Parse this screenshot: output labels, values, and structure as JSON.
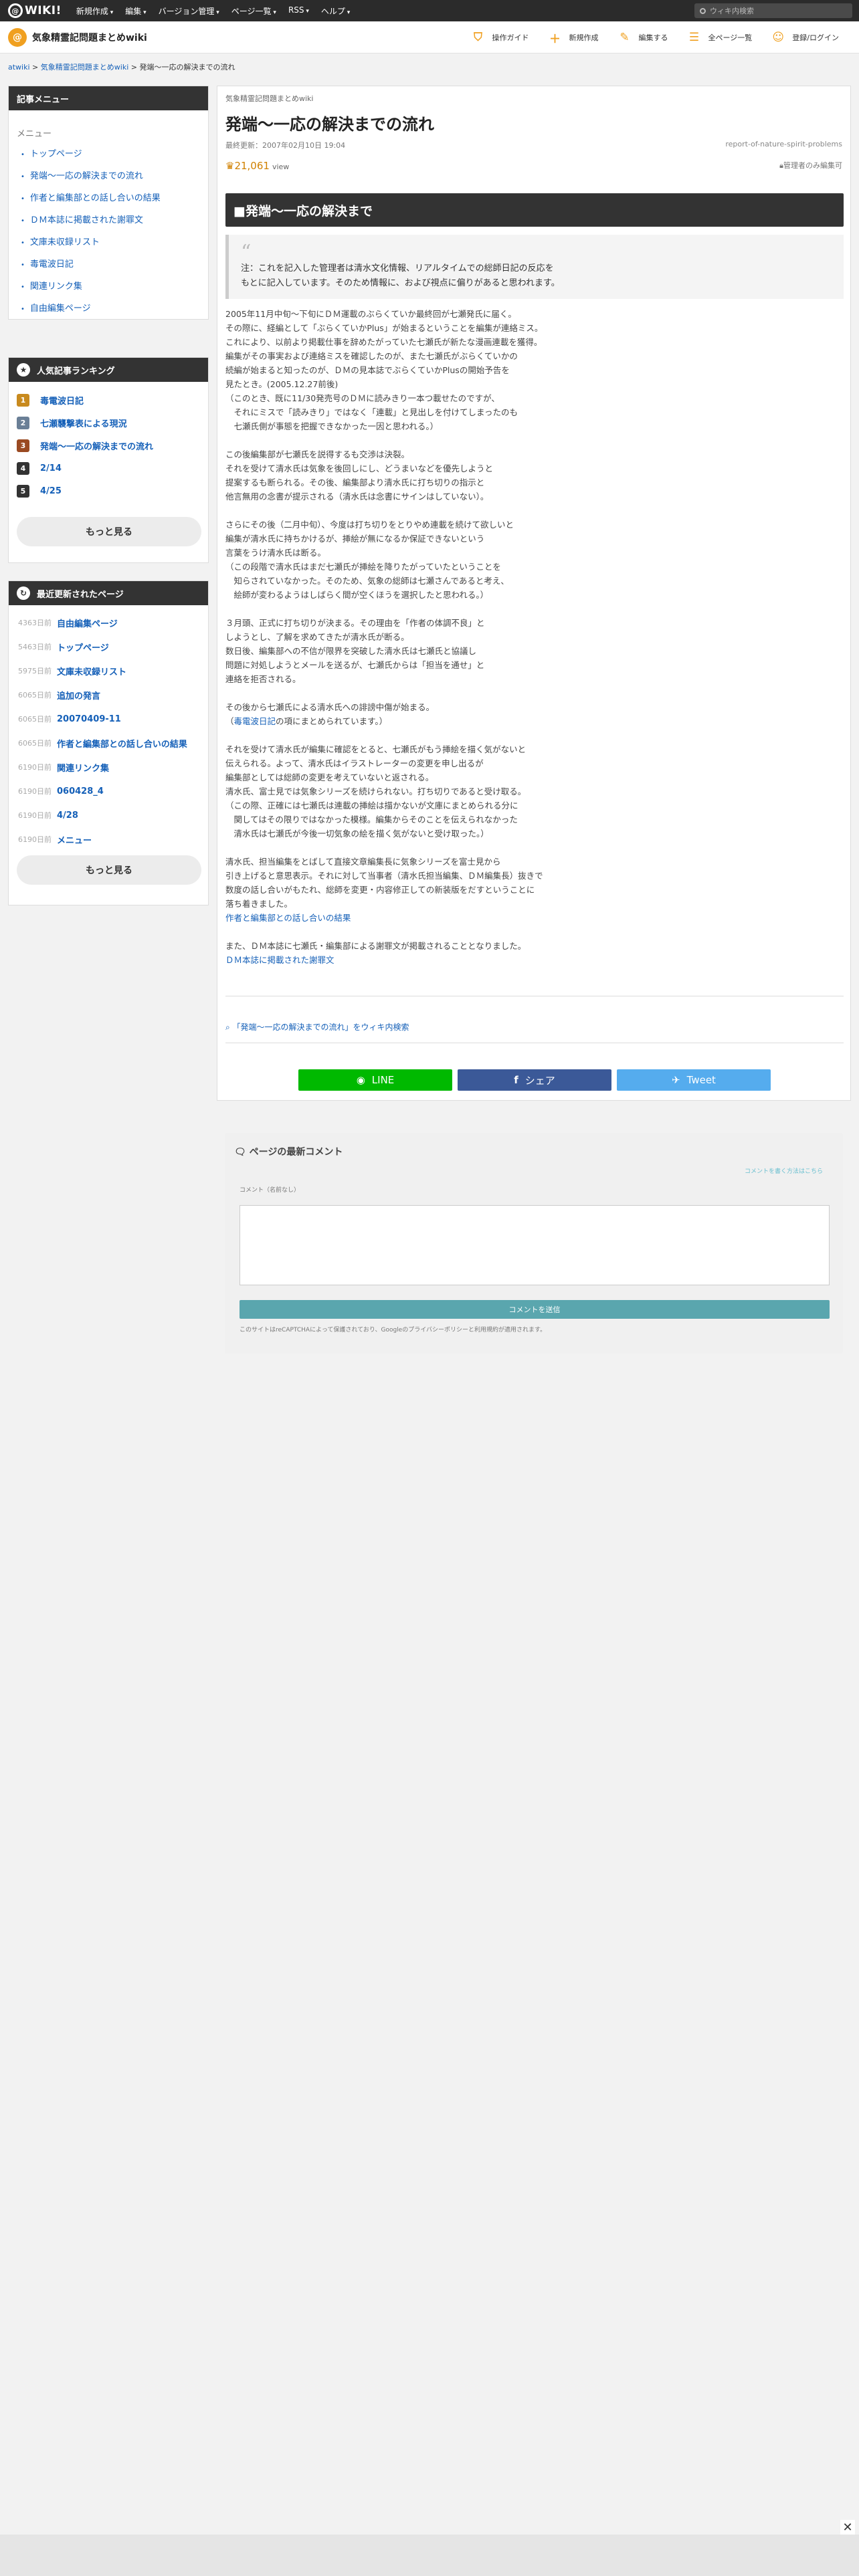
{
  "topbar": {
    "logo_text": "WIKI!",
    "menu": [
      "新規作成",
      "編集",
      "バージョン管理",
      "ページ一覧",
      "RSS",
      "ヘルプ"
    ],
    "search_placeholder": "ウィキ内検索"
  },
  "site": {
    "title": "気象精霊記問題まとめwiki",
    "nav": [
      "操作ガイド",
      "新規作成",
      "編集する",
      "全ページ一覧",
      "登録/ログイン"
    ]
  },
  "breadcrumb": {
    "root": "atwiki",
    "site": "気象精霊記問題まとめwiki",
    "current": "発端〜一応の解決までの流れ"
  },
  "sidebar": {
    "menu_title": "記事メニュー",
    "menu_caption": "メニュー",
    "menu_items": [
      "トップページ",
      "発端〜一応の解決までの流れ",
      "作者と編集部との話し合いの結果",
      "ＤＭ本誌に掲載された謝罪文",
      "文庫未収録リスト",
      "毒電波日記",
      "関連リンク集",
      "自由編集ページ"
    ],
    "ranking_title": "人気記事ランキング",
    "ranking": [
      {
        "rank": "1",
        "label": "毒電波日記",
        "color": "#c88a1e"
      },
      {
        "rank": "2",
        "label": "七瀬襲撃表による現況",
        "color": "#6a7f96"
      },
      {
        "rank": "3",
        "label": "発端〜一応の解決までの流れ",
        "color": "#9a4a22"
      },
      {
        "rank": "4",
        "label": "2/14",
        "color": "#333333"
      },
      {
        "rank": "5",
        "label": "4/25",
        "color": "#333333"
      }
    ],
    "more_label": "もっと見る",
    "recent_title": "最近更新されたページ",
    "recent": [
      {
        "ago": "4363日前",
        "label": "自由編集ページ"
      },
      {
        "ago": "5463日前",
        "label": "トップページ"
      },
      {
        "ago": "5975日前",
        "label": "文庫未収録リスト"
      },
      {
        "ago": "6065日前",
        "label": "追加の発言"
      },
      {
        "ago": "6065日前",
        "label": "20070409-11"
      },
      {
        "ago": "6065日前",
        "label": "作者と編集部との話し合いの結果"
      },
      {
        "ago": "6190日前",
        "label": "関連リンク集"
      },
      {
        "ago": "6190日前",
        "label": "060428_4"
      },
      {
        "ago": "6190日前",
        "label": "4/28"
      },
      {
        "ago": "6190日前",
        "label": "メニュー"
      }
    ]
  },
  "article": {
    "site_name": "気象精霊記問題まとめwiki",
    "title": "発端〜一応の解決までの流れ",
    "last_modified": "最終更新：2007年02月10日 19:04",
    "slug": "report-of-nature-spirit-problems",
    "views": "21,061",
    "views_unit": "view",
    "admin_only": "管理者のみ編集可",
    "heading": "■発端〜一応の解決まで",
    "quote": "注：これを記入した管理者は清水文化情報、リアルタイムでの総師日記の反応を\nもとに記入しています。そのため情報に、および視点に偏りがあると思われます。",
    "paragraphs": [
      "2005年11月中旬〜下旬にＤＭ運載のぶらくていか最終回が七瀬発氏に届く。\nその際に、経編として「ぶらくていかPlus」が始まるということを編集が連絡ミス。\nこれにより、以前より掲載仕事を辞めたがっていた七瀬氏が新たな漫画連載を獲得。\n編集がその事実および連絡ミスを確認したのが、また七瀬氏がぶらくていかの\n続編が始まると知ったのが、ＤＭの見本誌でぶらくていかPlusの開始予告を\n見たとき。(2005.12.27前後)\n（このとき、既に11/30発売号のＤＭに読みきり一本つ載せたのですが、\n　それにミスで「読みきり」ではなく「連載」と見出しを付けてしまったのも\n　七瀬氏側が事態を把握できなかった一因と思われる。）",
      "この後編集部が七瀬氏を説得するも交渉は決裂。\nそれを受けて清水氏は気象を後回しにし、どうまいなどを優先しようと\n提案するも断られる。その後、編集部より清水氏に打ち切りの指示と\n他言無用の念書が提示される（清水氏は念書にサインはしていない）。",
      "さらにその後（二月中旬）、今度は打ち切りをとりやめ連載を続けて欲しいと\n編集が清水氏に持ちかけるが、挿絵が無になるか保証できないという\n言葉をうけ清水氏は断る。\n（この段階で清水氏はまだ七瀬氏が挿絵を降りたがっていたということを\n　知らされていなかった。そのため、気象の総師は七瀬さんであると考え、\n　絵師が変わるようはしばらく間が空くほうを選択したと思われる。）",
      "３月頭、正式に打ち切りが決まる。その理由を「作者の体調不良」と\nしようとし、了解を求めてきたが清水氏が断る。\n数日後、編集部への不信が限界を突破した清水氏は七瀬氏と協議し\n問題に対処しようとメールを送るが、七瀬氏からは「担当を通せ」と\n連絡を拒否される。",
      "その後から七瀬氏による清水氏への誹謗中傷が始まる。\n（毒電波日記の項にまとめられています。）",
      "それを受けて清水氏が編集に確認をとると、七瀬氏がもう挿絵を描く気がないと\n伝えられる。よって、清水氏はイラストレーターの変更を申し出るが\n編集部としては総師の変更を考えていないと返される。\n清水氏、富士見では気象シリーズを続けられない。打ち切りであると受け取る。\n（この際、正確には七瀬氏は連載の挿絵は描かないが文庫にまとめられる分に\n　関してはその限りではなかった模様。編集からそのことを伝えられなかった\n　清水氏は七瀬氏が今後一切気象の絵を描く気がないと受け取った。）",
      "清水氏、担当編集をとばして直接文章編集長に気象シリーズを富士見から\n引き上げると意思表示。それに対して当事者（清水氏担当編集、ＤＭ編集長）抜きで\n数度の話し合いがもたれ、総師を変更・内容修正しての新装版をだすということに\n落ち着きました。",
      "また、ＤＭ本誌に七瀬氏・編集部による謝罪文が掲載されることとなりました。"
    ],
    "link_diary": "毒電波日記",
    "link_result": "作者と編集部との話し合いの結果",
    "link_apology": "ＤＭ本誌に掲載された謝罪文",
    "wiki_search": "「発端〜一応の解決までの流れ」をウィキ内検索",
    "share": {
      "line": "LINE",
      "facebook": "シェア",
      "twitter": "Tweet"
    }
  },
  "comment": {
    "title": "ページの最新コメント",
    "hint": "コメントを書く方法はこちら",
    "label": "コメント（名前なし）",
    "submit": "コメントを送信",
    "note": "このサイトはreCAPTCHAによって保護されており、Googleのプライバシーポリシーと利用規約が適用されます。"
  },
  "colors": {
    "accent": "#f0a020",
    "line": "#00b900",
    "facebook": "#3b5998",
    "twitter": "#55acee",
    "submit": "#5aa6ae"
  }
}
